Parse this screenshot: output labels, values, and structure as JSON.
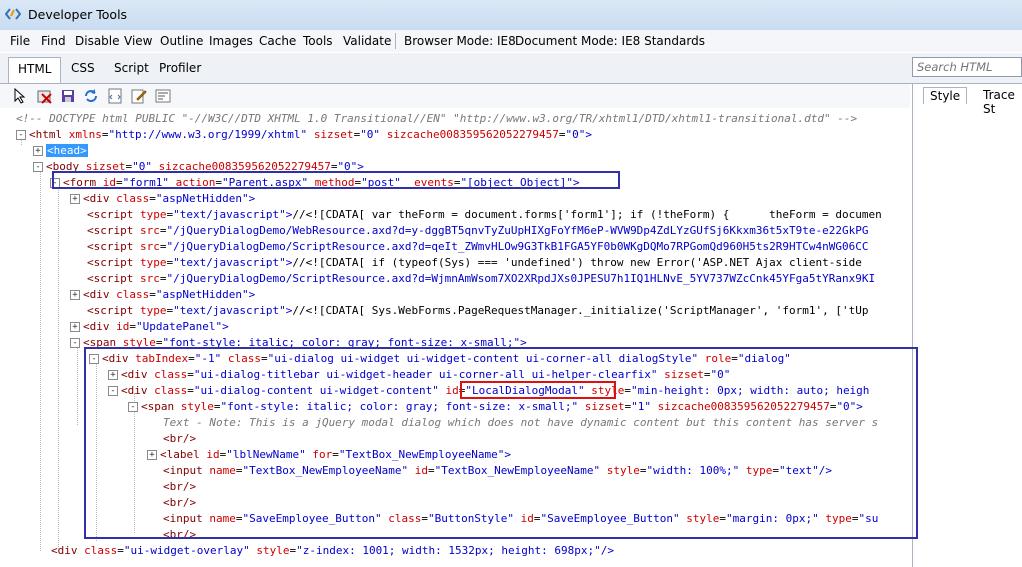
{
  "window": {
    "title": "Developer Tools"
  },
  "menu": {
    "items": [
      "File",
      "Find",
      "Disable",
      "View",
      "Outline",
      "Images",
      "Cache",
      "Tools",
      "Validate"
    ],
    "browser_mode": "Browser Mode: IE8",
    "document_mode": "Document Mode: IE8 Standards"
  },
  "tabs": [
    "HTML",
    "CSS",
    "Script",
    "Profiler"
  ],
  "search": {
    "placeholder": "Search HTML"
  },
  "right_tabs": [
    "Style",
    "Trace St"
  ],
  "tree_lines": [
    [
      "<!-- DOCTYPE html PUBLIC \"-//W3C//DTD XHTML 1.0 Transitional//EN\" \"http://www.w3.org/TR/xhtml1/DTD/xhtml1-transitional.dtd\" -->"
    ],
    [
      "<html",
      "xmlns",
      "\"http://www.w3.org/1999/xhtml\"",
      "sizset",
      "\"0\"",
      "sizcache008359562052279457",
      "\"0\">"
    ],
    [
      "<head>"
    ],
    [
      "<body",
      "sizset",
      "\"0\"",
      "sizcache008359562052279457",
      "\"0\">"
    ],
    [
      "<form",
      "id",
      "\"form1\"",
      "action",
      "\"Parent.aspx\"",
      "method",
      "\"post\"",
      "_events",
      "\"[object Object]\">"
    ],
    [
      "<div",
      "class",
      "\"aspNetHidden\">"
    ],
    [
      "<script",
      "type",
      "\"text/javascript\">",
      "//<![CDATA[ var theForm = document.forms['form1']; if (!theForm) {      theForm = documen"
    ],
    [
      "<script",
      "src",
      "\"/jQueryDialogDemo/WebResource.axd?d=y-dggBT5qnvTyZuUpHIXgFoYfM6eP-WVW9Dp4ZdLYzGUfSj6Kkxm36t5xT9te-e22GkPG"
    ],
    [
      "<script",
      "src",
      "\"/jQueryDialogDemo/ScriptResource.axd?d=qeIt_ZWmvHLOw9G3TkB1FGA5YF0b0WKgDQMo7RPGomQd960H5ts2R9HTCw4nWG06CC"
    ],
    [
      "<script",
      "type",
      "\"text/javascript\">",
      "//<![CDATA[ if (typeof(Sys) === 'undefined') throw new Error('ASP.NET Ajax client-side"
    ],
    [
      "<script",
      "src",
      "\"/jQueryDialogDemo/ScriptResource.axd?d=WjmnAmWsom7XO2XRpdJXs0JPESU7h1IQ1HLNvE_5YV737WZcCnk45YFga5tYRanx9KI"
    ],
    [
      "<div",
      "class",
      "\"aspNetHidden\">"
    ],
    [
      "<script",
      "type",
      "\"text/javascript\">",
      "//<![CDATA[ Sys.WebForms.PageRequestManager._initialize('ScriptManager', 'form1', ['tUp"
    ],
    [
      "<div",
      "id",
      "\"UpdatePanel\">"
    ],
    [
      "<span",
      "style",
      "\"font-style: italic; color: gray; font-size: x-small;\">"
    ],
    [
      "<div",
      "tabIndex",
      "\"-1\"",
      "class",
      "\"ui-dialog ui-widget ui-widget-content ui-corner-all dialogStyle\"",
      "role",
      "\"dialog\"",
      "aria-labell"
    ],
    [
      "<div",
      "class",
      "\"ui-dialog-titlebar ui-widget-header ui-corner-all ui-helper-clearfix\"",
      "sizset",
      "\"0\"",
      "jQuery17103659431284"
    ],
    [
      "<div",
      "class",
      "\"ui-dialog-content ui-widget-content\"",
      "id",
      "\"LocalDialogModal\"",
      "style",
      "\"min-height: 0px; width: auto; heigh"
    ],
    [
      "<span",
      "style",
      "\"font-style: italic; color: gray; font-size: x-small;\"",
      "sizset",
      "\"1\"",
      "sizcache008359562052279457",
      "\"0\">"
    ],
    [
      "Text - Note: This is a jQuery modal dialog which does not have dynamic content but this content has server s"
    ],
    [
      "<br/>"
    ],
    [
      "<label",
      "id",
      "\"lblNewName\"",
      "for",
      "\"TextBox_NewEmployeeName\">"
    ],
    [
      "<input",
      "name",
      "\"TextBox_NewEmployeeName\"",
      "id",
      "\"TextBox_NewEmployeeName\"",
      "style",
      "\"width: 100%;\"",
      "type",
      "\"text\"/>"
    ],
    [
      "<br/>"
    ],
    [
      "<br/>"
    ],
    [
      "<input",
      "name",
      "\"SaveEmployee_Button\"",
      "class",
      "\"ButtonStyle\"",
      "id",
      "\"SaveEmployee_Button\"",
      "style",
      "\"margin: 0px;\"",
      "type",
      "\"su"
    ],
    [
      "<br/>"
    ],
    [
      "<div",
      "class",
      "\"ui-widget-overlay\"",
      "style",
      "\"z-index: 1001; width: 1532px; height: 698px;\"/>"
    ]
  ]
}
